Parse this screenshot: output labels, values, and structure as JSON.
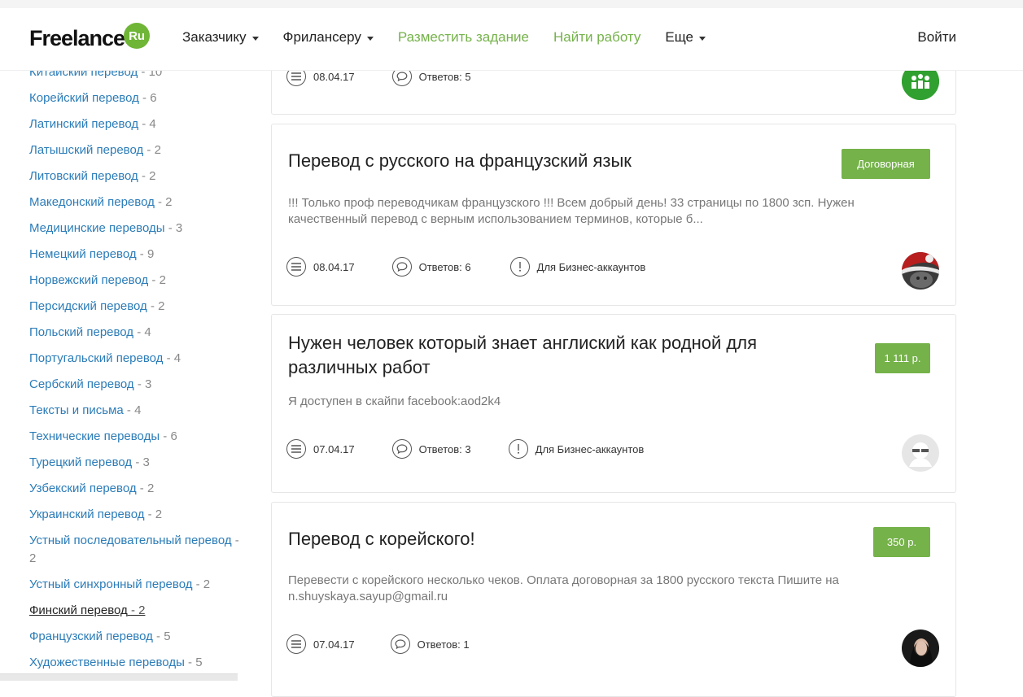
{
  "header": {
    "logo_text": "Freelance",
    "logo_badge": "Ru",
    "nav": [
      {
        "label": "Заказчику",
        "dropdown": true,
        "green": false
      },
      {
        "label": "Фрилансеру",
        "dropdown": true,
        "green": false
      },
      {
        "label": "Разместить задание",
        "dropdown": false,
        "green": true
      },
      {
        "label": "Найти работу",
        "dropdown": false,
        "green": true
      },
      {
        "label": "Еще",
        "dropdown": true,
        "green": false
      }
    ],
    "login_label": "Войти"
  },
  "sidebar": {
    "items": [
      {
        "name": "Китайский перевод",
        "count": "- 10"
      },
      {
        "name": "Корейский перевод",
        "count": "- 6"
      },
      {
        "name": "Латинский перевод",
        "count": "- 4"
      },
      {
        "name": "Латышский перевод",
        "count": "- 2"
      },
      {
        "name": "Литовский перевод",
        "count": "- 2"
      },
      {
        "name": "Македонский перевод",
        "count": "- 2"
      },
      {
        "name": "Медицинские переводы",
        "count": "- 3"
      },
      {
        "name": "Немецкий перевод",
        "count": "- 9"
      },
      {
        "name": "Норвежский перевод",
        "count": "- 2"
      },
      {
        "name": "Персидский перевод",
        "count": "- 2"
      },
      {
        "name": "Польский перевод",
        "count": "- 4"
      },
      {
        "name": "Португальский перевод",
        "count": "- 4"
      },
      {
        "name": "Сербский перевод",
        "count": "- 3"
      },
      {
        "name": "Тексты и письма",
        "count": "- 4"
      },
      {
        "name": "Технические переводы",
        "count": "- 6"
      },
      {
        "name": "Турецкий перевод",
        "count": "- 3"
      },
      {
        "name": "Узбекский перевод",
        "count": "- 2"
      },
      {
        "name": "Украинский перевод",
        "count": "- 2"
      },
      {
        "name": "Устный последовательный перевод",
        "count": "- 2"
      },
      {
        "name": "Устный синхронный перевод",
        "count": "- 2"
      },
      {
        "name": "Финский перевод",
        "count": "- 2",
        "active": true
      },
      {
        "name": "Французский перевод",
        "count": "- 5"
      },
      {
        "name": "Художественные переводы",
        "count": "- 5"
      }
    ]
  },
  "cards": [
    {
      "date": "08.04.17",
      "answers": "Ответов: 5",
      "avatar": "green-logo"
    },
    {
      "title": "Перевод с русского на французский язык",
      "price": "Договорная",
      "description": "!!! Только проф переводчикам французского !!! Всем добрый день! 33 страницы по 1800 зсп. Нужен качественный перевод с верным использованием терминов, которые б...",
      "date": "08.04.17",
      "answers": "Ответов: 6",
      "business": "Для Бизнес-аккаунтов",
      "avatar": "santa-hat-photo"
    },
    {
      "title": "Нужен человек который знает англиский как родной для различных работ",
      "price": "1 111 р.",
      "description": "Я доступен в скайпи facebook:aod2k4",
      "date": "07.04.17",
      "answers": "Ответов: 3",
      "business": "Для Бизнес-аккаунтов",
      "avatar": "default-person-sunglasses"
    },
    {
      "title": "Перевод с корейского!",
      "price": "350 р.",
      "description": "Перевести с корейского несколько чеков. Оплата договорная за 1800 русского текста Пишите на n.shuyskaya.sayup@gmail.ru",
      "date": "07.04.17",
      "answers": "Ответов: 1",
      "avatar": "woman-photo"
    }
  ],
  "colors": {
    "brand_green": "#75b24a",
    "link_blue": "#2b7cb8",
    "muted_text": "#777777"
  }
}
